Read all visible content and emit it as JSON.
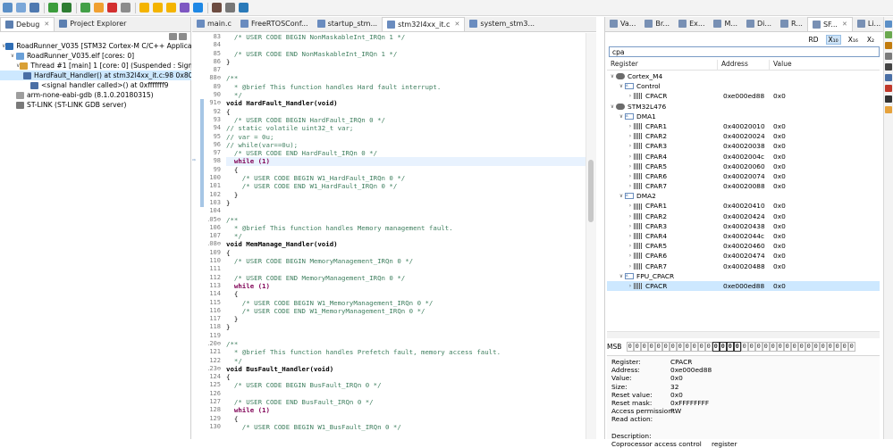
{
  "toolbar": {
    "icons": [
      "new-icon",
      "save-icon",
      "save-all-icon",
      "run-icon",
      "debug-icon",
      "resume-icon",
      "suspend-icon",
      "terminate-icon",
      "disconnect-icon",
      "step-into-icon",
      "step-over-icon",
      "step-return-icon",
      "instruction-step-icon",
      "restart-icon",
      "build-icon",
      "search-icon",
      "perspective-icon"
    ]
  },
  "debug_panel": {
    "tabs": [
      {
        "label": "Debug",
        "icon": "debug-bug-icon",
        "active": true
      },
      {
        "label": "Project Explorer",
        "icon": "project-explorer-icon",
        "active": false
      }
    ],
    "tree": [
      {
        "indent": 0,
        "arrow": "∨",
        "icon": "launch-config-icon",
        "text": "RoadRunner_V035 [STM32 Cortex-M C/C++ Application"
      },
      {
        "indent": 1,
        "arrow": "∨",
        "icon": "elf-icon",
        "text": "RoadRunner_V035.elf [cores: 0]"
      },
      {
        "indent": 2,
        "arrow": "∨",
        "icon": "thread-icon",
        "text": "Thread #1 [main] 1 [core: 0] (Suspended : Signal : "
      },
      {
        "indent": 3,
        "arrow": "",
        "icon": "stack-frame-icon",
        "text": "HardFault_Handler() at stm32l4xx_it.c:98 0x800",
        "selected": true
      },
      {
        "indent": 3,
        "arrow": "",
        "icon": "stack-frame-icon",
        "text": "<signal handler called>() at 0xfffffff9"
      },
      {
        "indent": 1,
        "arrow": "",
        "icon": "gdb-icon",
        "text": "arm-none-eabi-gdb (8.1.0.20180315)"
      },
      {
        "indent": 1,
        "arrow": "",
        "icon": "gdb-server-icon",
        "text": "ST-LINK (ST-LINK GDB server)"
      }
    ]
  },
  "editor": {
    "tabs": [
      {
        "label": "main.c",
        "active": false
      },
      {
        "label": "FreeRTOSConf...",
        "active": false
      },
      {
        "label": "startup_stm...",
        "active": false
      },
      {
        "label": "stm32l4xx_it.c",
        "active": true
      },
      {
        "label": "system_stm3...",
        "active": false
      }
    ],
    "lines": [
      {
        "n": "83",
        "t": "  /* USER CODE BEGIN NonMaskableInt_IRQn 1 */",
        "k": "cm"
      },
      {
        "n": "84",
        "t": "",
        "k": ""
      },
      {
        "n": "85",
        "t": "  /* USER CODE END NonMaskableInt_IRQn 1 */",
        "k": "cm"
      },
      {
        "n": "86",
        "t": "}",
        "k": ""
      },
      {
        "n": "87",
        "t": "",
        "k": ""
      },
      {
        "n": "88⊖",
        "t": "/**",
        "k": "cm"
      },
      {
        "n": "89",
        "t": "  * @brief This function handles Hard fault interrupt.",
        "k": "cm"
      },
      {
        "n": "90",
        "t": "  */",
        "k": "cm"
      },
      {
        "n": "91⊖",
        "t": "void HardFault_Handler(void)",
        "k": "fn",
        "mark": true
      },
      {
        "n": "92",
        "t": "{",
        "k": "",
        "mark": true
      },
      {
        "n": "93",
        "t": "  /* USER CODE BEGIN HardFault_IRQn 0 */",
        "k": "cm",
        "mark": true
      },
      {
        "n": "94",
        "t": "// static volatile uint32_t var;",
        "k": "cm",
        "mark": true
      },
      {
        "n": "95",
        "t": "// var = 0u;",
        "k": "cm",
        "mark": true
      },
      {
        "n": "96",
        "t": "// while(var==0u);",
        "k": "cm",
        "mark": true
      },
      {
        "n": "97",
        "t": "  /* USER CODE END HardFault_IRQn 0 */",
        "k": "cm",
        "mark": true
      },
      {
        "n": "98",
        "t": "  while (1)",
        "k": "kwl",
        "mark": true,
        "current": true
      },
      {
        "n": "99",
        "t": "  {",
        "k": "",
        "mark": true
      },
      {
        "n": "100",
        "t": "    /* USER CODE BEGIN W1_HardFault_IRQn 0 */",
        "k": "cm",
        "mark": true
      },
      {
        "n": "101",
        "t": "    /* USER CODE END W1_HardFault_IRQn 0 */",
        "k": "cm",
        "mark": true
      },
      {
        "n": "102",
        "t": "  }",
        "k": "",
        "mark": true
      },
      {
        "n": "103",
        "t": "}",
        "k": "",
        "mark": true
      },
      {
        "n": "104",
        "t": "",
        "k": ""
      },
      {
        "n": "105⊖",
        "t": "/**",
        "k": "cm"
      },
      {
        "n": "106",
        "t": "  * @brief This function handles Memory management fault.",
        "k": "cm"
      },
      {
        "n": "107",
        "t": "  */",
        "k": "cm"
      },
      {
        "n": "108⊖",
        "t": "void MemManage_Handler(void)",
        "k": "fn"
      },
      {
        "n": "109",
        "t": "{",
        "k": ""
      },
      {
        "n": "110",
        "t": "  /* USER CODE BEGIN MemoryManagement_IRQn 0 */",
        "k": "cm"
      },
      {
        "n": "111",
        "t": "",
        "k": ""
      },
      {
        "n": "112",
        "t": "  /* USER CODE END MemoryManagement_IRQn 0 */",
        "k": "cm"
      },
      {
        "n": "113",
        "t": "  while (1)",
        "k": "kwl"
      },
      {
        "n": "114",
        "t": "  {",
        "k": ""
      },
      {
        "n": "115",
        "t": "    /* USER CODE BEGIN W1_MemoryManagement_IRQn 0 */",
        "k": "cm"
      },
      {
        "n": "116",
        "t": "    /* USER CODE END W1_MemoryManagement_IRQn 0 */",
        "k": "cm"
      },
      {
        "n": "117",
        "t": "  }",
        "k": ""
      },
      {
        "n": "118",
        "t": "}",
        "k": ""
      },
      {
        "n": "119",
        "t": "",
        "k": ""
      },
      {
        "n": "120⊖",
        "t": "/**",
        "k": "cm"
      },
      {
        "n": "121",
        "t": "  * @brief This function handles Prefetch fault, memory access fault.",
        "k": "cm"
      },
      {
        "n": "122",
        "t": "  */",
        "k": "cm"
      },
      {
        "n": "123⊖",
        "t": "void BusFault_Handler(void)",
        "k": "fn"
      },
      {
        "n": "124",
        "t": "{",
        "k": ""
      },
      {
        "n": "125",
        "t": "  /* USER CODE BEGIN BusFault_IRQn 0 */",
        "k": "cm"
      },
      {
        "n": "126",
        "t": "",
        "k": ""
      },
      {
        "n": "127",
        "t": "  /* USER CODE END BusFault_IRQn 0 */",
        "k": "cm"
      },
      {
        "n": "128",
        "t": "  while (1)",
        "k": "kwl"
      },
      {
        "n": "129",
        "t": "  {",
        "k": ""
      },
      {
        "n": "130",
        "t": "    /* USER CODE BEGIN W1_BusFault_IRQn 0 */",
        "k": "cm"
      }
    ]
  },
  "sfr_panel": {
    "tabs": [
      {
        "label": "Va...",
        "active": false
      },
      {
        "label": "Br...",
        "active": false
      },
      {
        "label": "Ex...",
        "active": false
      },
      {
        "label": "M...",
        "active": false
      },
      {
        "label": "Di...",
        "active": false
      },
      {
        "label": "R...",
        "active": false
      },
      {
        "label": "SF...",
        "active": true
      },
      {
        "label": "Li...",
        "active": false
      }
    ],
    "toolbar_buttons": [
      "RD",
      "X₁₀",
      "X₁₆",
      "X₂"
    ],
    "search_value": "cpa",
    "columns": [
      "Register",
      "Address",
      "Value"
    ],
    "rows": [
      {
        "indent": 0,
        "arrow": "∨",
        "icon": "peripheral-group-icon",
        "name": "Cortex_M4",
        "address": "",
        "value": ""
      },
      {
        "indent": 1,
        "arrow": "∨",
        "icon": "peripheral-icon",
        "name": "Control",
        "address": "",
        "value": ""
      },
      {
        "indent": 2,
        "arrow": "›",
        "icon": "register-icon",
        "name": "CPACR",
        "address": "0xe000ed88",
        "value": "0x0"
      },
      {
        "indent": 0,
        "arrow": "∨",
        "icon": "peripheral-group-icon",
        "name": "STM32L476",
        "address": "",
        "value": ""
      },
      {
        "indent": 1,
        "arrow": "∨",
        "icon": "peripheral-icon",
        "name": "DMA1",
        "address": "",
        "value": ""
      },
      {
        "indent": 2,
        "arrow": "›",
        "icon": "register-icon",
        "name": "CPAR1",
        "address": "0x40020010",
        "value": "0x0"
      },
      {
        "indent": 2,
        "arrow": "›",
        "icon": "register-icon",
        "name": "CPAR2",
        "address": "0x40020024",
        "value": "0x0"
      },
      {
        "indent": 2,
        "arrow": "›",
        "icon": "register-icon",
        "name": "CPAR3",
        "address": "0x40020038",
        "value": "0x0"
      },
      {
        "indent": 2,
        "arrow": "›",
        "icon": "register-icon",
        "name": "CPAR4",
        "address": "0x4002004c",
        "value": "0x0"
      },
      {
        "indent": 2,
        "arrow": "›",
        "icon": "register-icon",
        "name": "CPAR5",
        "address": "0x40020060",
        "value": "0x0"
      },
      {
        "indent": 2,
        "arrow": "›",
        "icon": "register-icon",
        "name": "CPAR6",
        "address": "0x40020074",
        "value": "0x0"
      },
      {
        "indent": 2,
        "arrow": "›",
        "icon": "register-icon",
        "name": "CPAR7",
        "address": "0x40020088",
        "value": "0x0"
      },
      {
        "indent": 1,
        "arrow": "∨",
        "icon": "peripheral-icon",
        "name": "DMA2",
        "address": "",
        "value": ""
      },
      {
        "indent": 2,
        "arrow": "›",
        "icon": "register-icon",
        "name": "CPAR1",
        "address": "0x40020410",
        "value": "0x0"
      },
      {
        "indent": 2,
        "arrow": "›",
        "icon": "register-icon",
        "name": "CPAR2",
        "address": "0x40020424",
        "value": "0x0"
      },
      {
        "indent": 2,
        "arrow": "›",
        "icon": "register-icon",
        "name": "CPAR3",
        "address": "0x40020438",
        "value": "0x0"
      },
      {
        "indent": 2,
        "arrow": "›",
        "icon": "register-icon",
        "name": "CPAR4",
        "address": "0x4002044c",
        "value": "0x0"
      },
      {
        "indent": 2,
        "arrow": "›",
        "icon": "register-icon",
        "name": "CPAR5",
        "address": "0x40020460",
        "value": "0x0"
      },
      {
        "indent": 2,
        "arrow": "›",
        "icon": "register-icon",
        "name": "CPAR6",
        "address": "0x40020474",
        "value": "0x0"
      },
      {
        "indent": 2,
        "arrow": "›",
        "icon": "register-icon",
        "name": "CPAR7",
        "address": "0x40020488",
        "value": "0x0"
      },
      {
        "indent": 1,
        "arrow": "∨",
        "icon": "peripheral-icon",
        "name": "FPU_CPACR",
        "address": "",
        "value": ""
      },
      {
        "indent": 2,
        "arrow": "›",
        "icon": "register-icon",
        "name": "CPACR",
        "address": "0xe000ed88",
        "value": "0x0",
        "selected": true
      }
    ],
    "bits_label": "MSB",
    "bits": [
      "0",
      "0",
      "0",
      "0",
      "0",
      "0",
      "0",
      "0",
      "0",
      "0",
      "0",
      "0",
      "0",
      "0",
      "0",
      "0",
      "0",
      "0",
      "0",
      "0",
      "0",
      "0",
      "0",
      "0",
      "0",
      "0",
      "0",
      "0",
      "0",
      "0",
      "0",
      "0"
    ],
    "details": [
      {
        "k": "Register:",
        "v": "CPACR"
      },
      {
        "k": "Address:",
        "v": "0xe000ed88"
      },
      {
        "k": "Value:",
        "v": "0x0"
      },
      {
        "k": "Size:",
        "v": "32"
      },
      {
        "k": "Reset value:",
        "v": "0x0"
      },
      {
        "k": "Reset mask:",
        "v": "0xFFFFFFFF"
      },
      {
        "k": "Access permission:",
        "v": "RW"
      },
      {
        "k": "Read action:",
        "v": ""
      },
      {
        "k": "",
        "v": ""
      },
      {
        "k": "Description:",
        "v": ""
      },
      {
        "k": "Coprocessor access control",
        "v": "register"
      }
    ]
  },
  "colors": {
    "selection": "#cde8ff",
    "comment": "#3f7f5f",
    "keyword": "#7f0055",
    "current_line": "#e8f2fe",
    "breakpoint_bar": "#a6c6e6"
  }
}
